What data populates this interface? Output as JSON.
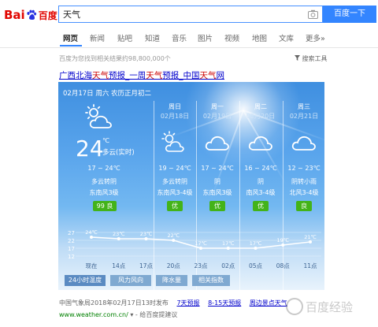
{
  "logo": {
    "part1": "Bai",
    "part2": "du",
    "cn": "百度"
  },
  "search": {
    "query": "天气",
    "button": "百度一下"
  },
  "nav": {
    "items": [
      "网页",
      "新闻",
      "贴吧",
      "知道",
      "音乐",
      "图片",
      "视频",
      "地图",
      "文库",
      "更多»"
    ]
  },
  "result_count": "百度为您找到相关结果约98,800,000个",
  "search_tools": "搜索工具",
  "result": {
    "title_parts": [
      "广西北海",
      "天气",
      "预报_一周",
      "天气",
      "预报_中国",
      "天气",
      "网"
    ],
    "date_line": "02月17日 周六 农历正月初二",
    "today": {
      "temp": "24",
      "unit": "℃",
      "condition": "多云(实时)",
      "range": "17 ~ 24℃",
      "desc": "多云转阴",
      "wind": "东南风3级",
      "aqi": "99 良"
    },
    "days": [
      {
        "weekday": "周日",
        "date": "02月18日",
        "range": "19 ~ 24℃",
        "desc": "多云转阴",
        "wind": "东南风3-4级",
        "aqi": "优",
        "icon": "partly-cloudy-icon"
      },
      {
        "weekday": "周一",
        "date": "02月19日",
        "range": "17 ~ 24℃",
        "desc": "阴",
        "wind": "东南风3级",
        "aqi": "优",
        "icon": "cloudy-icon"
      },
      {
        "weekday": "周二",
        "date": "02月20日",
        "range": "16 ~ 24℃",
        "desc": "阴",
        "wind": "南风3-4级",
        "aqi": "优",
        "icon": "cloudy-icon"
      },
      {
        "weekday": "周三",
        "date": "02月21日",
        "range": "12 ~ 23℃",
        "desc": "阴转小雨",
        "wind": "北风3-4级",
        "aqi": "良",
        "icon": "cloudy-icon"
      }
    ],
    "tabs": [
      "24小时温度",
      "风力风向",
      "降水量",
      "相关指数"
    ]
  },
  "chart_data": {
    "type": "line",
    "x": [
      "现在",
      "14点",
      "17点",
      "20点",
      "23点",
      "02点",
      "05点",
      "08点",
      "11点"
    ],
    "values": [
      24,
      23,
      23,
      22,
      17,
      17,
      17,
      19,
      21
    ],
    "labels": [
      "24℃",
      "23℃",
      "23℃",
      "22℃",
      "17℃",
      "17℃",
      "17℃",
      "19℃",
      "21℃"
    ],
    "yticks": [
      27,
      22,
      17,
      12
    ],
    "ylim": [
      12,
      27
    ]
  },
  "footer": {
    "source": "中国气象局2018年02月17日13时发布",
    "links": [
      "7天预报",
      "8-15天预报",
      "周边景点天气"
    ],
    "url": "www.weather.com.cn/",
    "snapshot": "给百度提建议"
  },
  "watermark": "百度经验"
}
